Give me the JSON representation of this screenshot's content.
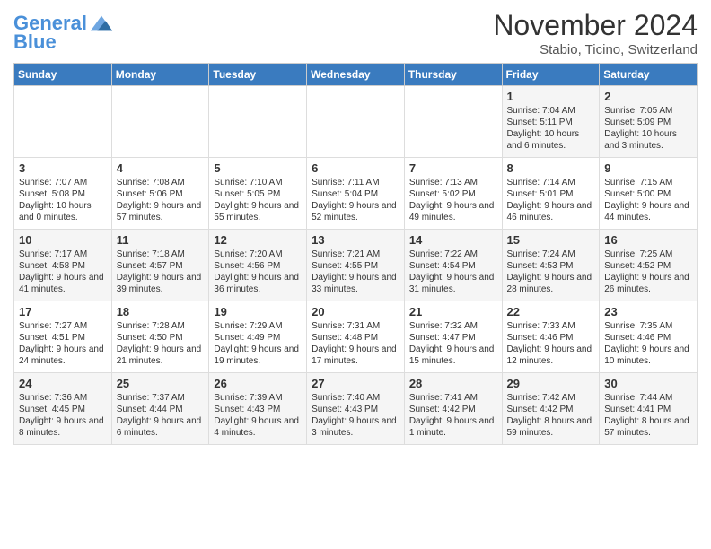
{
  "header": {
    "logo_line1": "General",
    "logo_line2": "Blue",
    "month": "November 2024",
    "location": "Stabio, Ticino, Switzerland"
  },
  "days_of_week": [
    "Sunday",
    "Monday",
    "Tuesday",
    "Wednesday",
    "Thursday",
    "Friday",
    "Saturday"
  ],
  "weeks": [
    [
      {
        "day": "",
        "content": ""
      },
      {
        "day": "",
        "content": ""
      },
      {
        "day": "",
        "content": ""
      },
      {
        "day": "",
        "content": ""
      },
      {
        "day": "",
        "content": ""
      },
      {
        "day": "1",
        "content": "Sunrise: 7:04 AM\nSunset: 5:11 PM\nDaylight: 10 hours and 6 minutes."
      },
      {
        "day": "2",
        "content": "Sunrise: 7:05 AM\nSunset: 5:09 PM\nDaylight: 10 hours and 3 minutes."
      }
    ],
    [
      {
        "day": "3",
        "content": "Sunrise: 7:07 AM\nSunset: 5:08 PM\nDaylight: 10 hours and 0 minutes."
      },
      {
        "day": "4",
        "content": "Sunrise: 7:08 AM\nSunset: 5:06 PM\nDaylight: 9 hours and 57 minutes."
      },
      {
        "day": "5",
        "content": "Sunrise: 7:10 AM\nSunset: 5:05 PM\nDaylight: 9 hours and 55 minutes."
      },
      {
        "day": "6",
        "content": "Sunrise: 7:11 AM\nSunset: 5:04 PM\nDaylight: 9 hours and 52 minutes."
      },
      {
        "day": "7",
        "content": "Sunrise: 7:13 AM\nSunset: 5:02 PM\nDaylight: 9 hours and 49 minutes."
      },
      {
        "day": "8",
        "content": "Sunrise: 7:14 AM\nSunset: 5:01 PM\nDaylight: 9 hours and 46 minutes."
      },
      {
        "day": "9",
        "content": "Sunrise: 7:15 AM\nSunset: 5:00 PM\nDaylight: 9 hours and 44 minutes."
      }
    ],
    [
      {
        "day": "10",
        "content": "Sunrise: 7:17 AM\nSunset: 4:58 PM\nDaylight: 9 hours and 41 minutes."
      },
      {
        "day": "11",
        "content": "Sunrise: 7:18 AM\nSunset: 4:57 PM\nDaylight: 9 hours and 39 minutes."
      },
      {
        "day": "12",
        "content": "Sunrise: 7:20 AM\nSunset: 4:56 PM\nDaylight: 9 hours and 36 minutes."
      },
      {
        "day": "13",
        "content": "Sunrise: 7:21 AM\nSunset: 4:55 PM\nDaylight: 9 hours and 33 minutes."
      },
      {
        "day": "14",
        "content": "Sunrise: 7:22 AM\nSunset: 4:54 PM\nDaylight: 9 hours and 31 minutes."
      },
      {
        "day": "15",
        "content": "Sunrise: 7:24 AM\nSunset: 4:53 PM\nDaylight: 9 hours and 28 minutes."
      },
      {
        "day": "16",
        "content": "Sunrise: 7:25 AM\nSunset: 4:52 PM\nDaylight: 9 hours and 26 minutes."
      }
    ],
    [
      {
        "day": "17",
        "content": "Sunrise: 7:27 AM\nSunset: 4:51 PM\nDaylight: 9 hours and 24 minutes."
      },
      {
        "day": "18",
        "content": "Sunrise: 7:28 AM\nSunset: 4:50 PM\nDaylight: 9 hours and 21 minutes."
      },
      {
        "day": "19",
        "content": "Sunrise: 7:29 AM\nSunset: 4:49 PM\nDaylight: 9 hours and 19 minutes."
      },
      {
        "day": "20",
        "content": "Sunrise: 7:31 AM\nSunset: 4:48 PM\nDaylight: 9 hours and 17 minutes."
      },
      {
        "day": "21",
        "content": "Sunrise: 7:32 AM\nSunset: 4:47 PM\nDaylight: 9 hours and 15 minutes."
      },
      {
        "day": "22",
        "content": "Sunrise: 7:33 AM\nSunset: 4:46 PM\nDaylight: 9 hours and 12 minutes."
      },
      {
        "day": "23",
        "content": "Sunrise: 7:35 AM\nSunset: 4:46 PM\nDaylight: 9 hours and 10 minutes."
      }
    ],
    [
      {
        "day": "24",
        "content": "Sunrise: 7:36 AM\nSunset: 4:45 PM\nDaylight: 9 hours and 8 minutes."
      },
      {
        "day": "25",
        "content": "Sunrise: 7:37 AM\nSunset: 4:44 PM\nDaylight: 9 hours and 6 minutes."
      },
      {
        "day": "26",
        "content": "Sunrise: 7:39 AM\nSunset: 4:43 PM\nDaylight: 9 hours and 4 minutes."
      },
      {
        "day": "27",
        "content": "Sunrise: 7:40 AM\nSunset: 4:43 PM\nDaylight: 9 hours and 3 minutes."
      },
      {
        "day": "28",
        "content": "Sunrise: 7:41 AM\nSunset: 4:42 PM\nDaylight: 9 hours and 1 minute."
      },
      {
        "day": "29",
        "content": "Sunrise: 7:42 AM\nSunset: 4:42 PM\nDaylight: 8 hours and 59 minutes."
      },
      {
        "day": "30",
        "content": "Sunrise: 7:44 AM\nSunset: 4:41 PM\nDaylight: 8 hours and 57 minutes."
      }
    ]
  ]
}
